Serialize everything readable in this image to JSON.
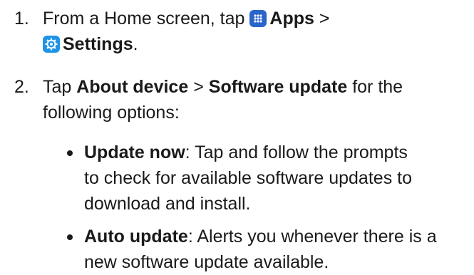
{
  "step1": {
    "number": "1.",
    "prefix": "From a Home screen, tap",
    "apps_label": "Apps",
    "separator": ">",
    "settings_label": "Settings",
    "suffix": ".",
    "icons": [
      "apps-icon",
      "settings-icon"
    ]
  },
  "step2": {
    "number": "2.",
    "prefix": "Tap",
    "about_label": "About device",
    "separator": ">",
    "software_label": "Software update",
    "rest_line1": "for the",
    "rest_line2": "following options:"
  },
  "bullets": [
    {
      "title": "Update now",
      "line1": ": Tap and follow the prompts",
      "line2": "to check for available software updates to",
      "line3": "download and install."
    },
    {
      "title": "Auto update",
      "line1": ": Alerts you whenever there is a",
      "line2": "new software update available."
    }
  ],
  "colors": {
    "apps_icon": "#2a66c9",
    "settings_icon": "#1f94e6",
    "text": "#1a1a1a"
  }
}
